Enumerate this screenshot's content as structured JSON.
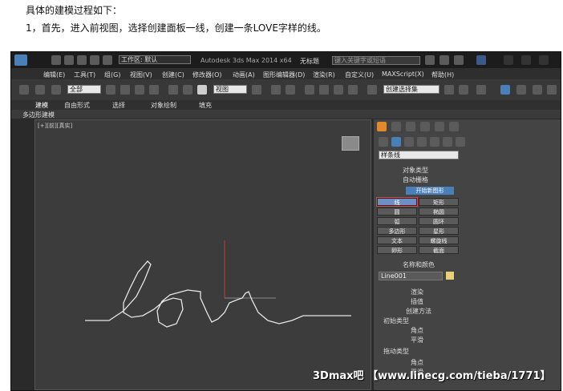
{
  "doc": {
    "heading": "具体的建模过程如下：",
    "step1": "1，首先，进入前视图，选择创建面板一线，创建一条LOVE字样的线。"
  },
  "app": {
    "title": "Autodesk 3ds Max 2014 x64",
    "untitled": "无标题",
    "workspace": "工作区: 默认",
    "search_placeholder": "键入关键字或短语"
  },
  "menu": [
    "编辑(E)",
    "工具(T)",
    "组(G)",
    "视图(V)",
    "创建(C)",
    "修改器(O)",
    "动画(A)",
    "图形编辑器(D)",
    "渲染(R)",
    "自定义(U)",
    "MAXScript(X)",
    "帮助(H)"
  ],
  "toolbar": {
    "filter": "全部",
    "ref_coord": "视图",
    "selection_set": "创建选择集"
  },
  "ribbon": {
    "tabs": [
      "建模",
      "自由形式",
      "选择",
      "对象绘制",
      "填充"
    ],
    "sub": "多边形建模"
  },
  "viewport": {
    "label": "[+][前][真实]"
  },
  "panel": {
    "category": "样条线",
    "object_type_title": "对象类型",
    "autogrid": "自动栅格",
    "start_new_shape": "开始新图形",
    "shapes": [
      "线",
      "矩形",
      "圆",
      "椭圆",
      "弧",
      "圆环",
      "多边形",
      "星形",
      "文本",
      "螺旋线",
      "卵形",
      "截面"
    ],
    "name_color_title": "名称和颜色",
    "object_name": "Line001",
    "rollouts": [
      "渲染",
      "插值",
      "创建方法"
    ],
    "initial_type_title": "初始类型",
    "initial_options": [
      "角点",
      "平滑"
    ],
    "drag_type_title": "拖动类型",
    "drag_options": [
      "角点",
      "平滑"
    ]
  },
  "watermark": "3Dmax吧 【www.linecg.com/tieba/1771】",
  "colors": {
    "accent": "#4a7fb8",
    "viewport_bg": "#3c3c3c",
    "swatch": "#e8d07a"
  }
}
